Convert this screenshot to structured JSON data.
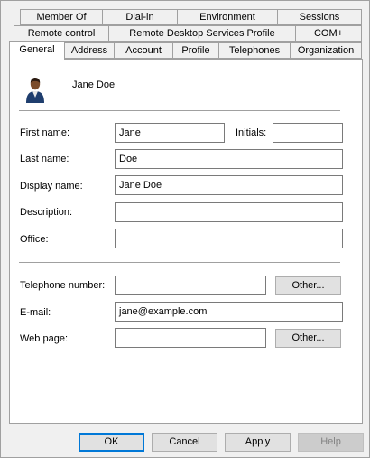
{
  "tabs_row1": [
    "Member Of",
    "Dial-in",
    "Environment",
    "Sessions"
  ],
  "tabs_row2": [
    "Remote control",
    "Remote Desktop Services Profile",
    "COM+"
  ],
  "tabs_row3": [
    "General",
    "Address",
    "Account",
    "Profile",
    "Telephones",
    "Organization"
  ],
  "user": {
    "name": "Jane Doe"
  },
  "fields": {
    "first_name_label": "First name:",
    "first_name_value": "Jane",
    "initials_label": "Initials:",
    "initials_value": "",
    "last_name_label": "Last name:",
    "last_name_value": "Doe",
    "display_name_label": "Display name:",
    "display_name_value": "Jane Doe",
    "description_label": "Description:",
    "description_value": "",
    "office_label": "Office:",
    "office_value": "",
    "telephone_label": "Telephone number:",
    "telephone_value": "",
    "email_label": "E-mail:",
    "email_value": "jane@example.com",
    "webpage_label": "Web page:",
    "webpage_value": ""
  },
  "buttons": {
    "telephone_other": "Other...",
    "webpage_other": "Other...",
    "ok": "OK",
    "cancel": "Cancel",
    "apply": "Apply",
    "help": "Help"
  },
  "colors": {
    "focus_blue": "#0078d7",
    "panel_bg": "#ffffff",
    "dialog_bg": "#f0f0f0"
  }
}
